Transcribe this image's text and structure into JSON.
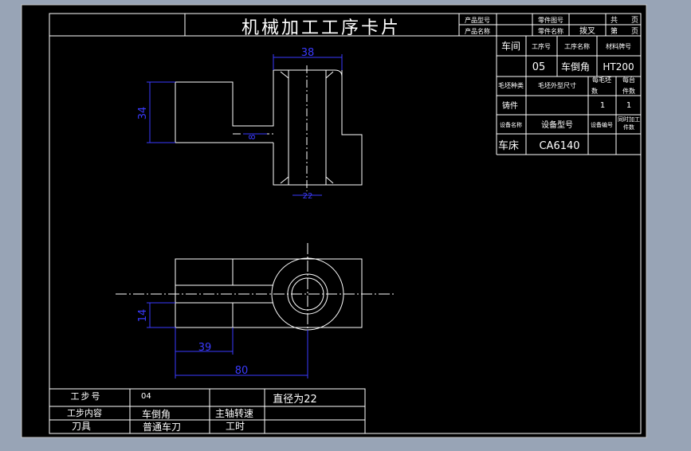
{
  "card": {
    "title": "机械加工工序卡片",
    "product_model_label": "产品型号",
    "product_name_label": "产品名称",
    "part_drawing_label": "零件图号",
    "part_name_label": "零件名称",
    "part_name_value": "拨叉",
    "total_label": "共",
    "page_label": "页",
    "sheet_label": "第",
    "sheet_page_label": "页"
  },
  "info": {
    "workshop_label": "车间",
    "process_no_label": "工序号",
    "process_name_label": "工序名称",
    "material_label": "材料牌号",
    "process_no": "05",
    "process_name": "车倒角",
    "material": "HT200",
    "blank_type_label": "毛坯种类",
    "blank_size_label": "毛坯外型尺寸",
    "blank_count_label": "每毛坯",
    "blank_count_label2": "数",
    "part_count_label": "每台",
    "part_count_label2": "件数",
    "blank_type": "铸件",
    "blank_count": "1",
    "part_count": "1",
    "equip_name_label": "设备名称",
    "equip_model_label": "设备型号",
    "equip_no_label": "设备编号",
    "simul_label": "同时加工",
    "simul_label2": "件数",
    "equip_name": "车床",
    "equip_model": "CA6140"
  },
  "steps": {
    "step_no_label": "工步号",
    "step_no": "04",
    "step_content_label": "工步内容",
    "step_content": "车倒角",
    "tool_label": "刀具",
    "tool": "普通车刀",
    "remark": "直径为22",
    "spindle_label": "主轴转速",
    "time_label": "工时"
  },
  "dims": {
    "top_width": "38",
    "left_height": "34",
    "neck": "8",
    "bottom_bore": "22",
    "front_height": "14",
    "front_39": "39",
    "front_80": "80"
  },
  "colors": {
    "background": "#98a4b6",
    "drawing": "#000000",
    "line": "#ffffff",
    "dimension": "#3a3aff"
  }
}
